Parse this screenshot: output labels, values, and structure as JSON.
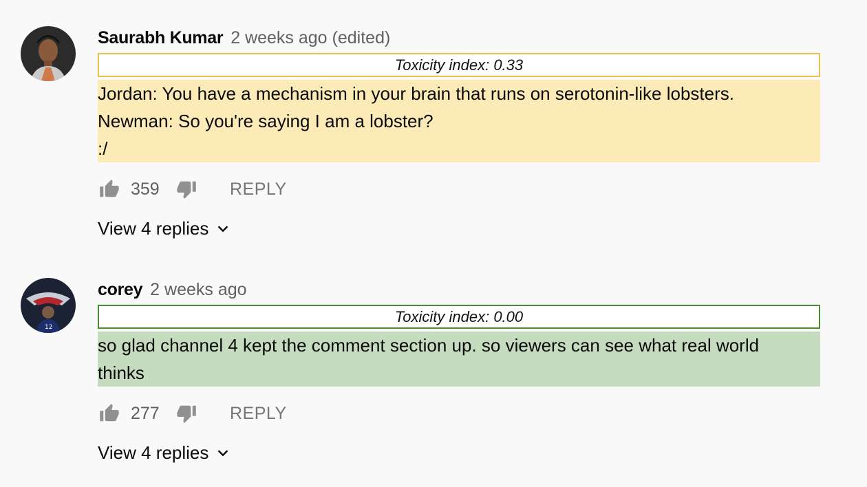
{
  "comments": [
    {
      "author": "Saurabh Kumar",
      "time": "2 weeks ago (edited)",
      "toxicity": "Toxicity index: 0.33",
      "tox_color": "#e7c24a",
      "highlight_color": "#fdebb7",
      "lines": [
        "Jordan: You have a mechanism in your brain that runs on serotonin-like lobsters.",
        "Newman: So you're saying I am a lobster?",
        ":/"
      ],
      "likes": "359",
      "reply_label": "REPLY",
      "view_replies": "View 4 replies",
      "avatar_icon": "user-avatar"
    },
    {
      "author": "corey",
      "time": "2 weeks ago",
      "toxicity": "Toxicity index: 0.00",
      "tox_color": "#4c8a36",
      "highlight_color": "#c5dcbf",
      "lines": [
        "so glad channel 4 kept the comment section up. so viewers can see what real world",
        "thinks"
      ],
      "likes": "277",
      "reply_label": "REPLY",
      "view_replies": "View 4 replies",
      "avatar_icon": "user-avatar"
    }
  ],
  "icons": {
    "like": "thumbs-up-icon",
    "dislike": "thumbs-down-icon",
    "expand": "chevron-down-icon"
  }
}
